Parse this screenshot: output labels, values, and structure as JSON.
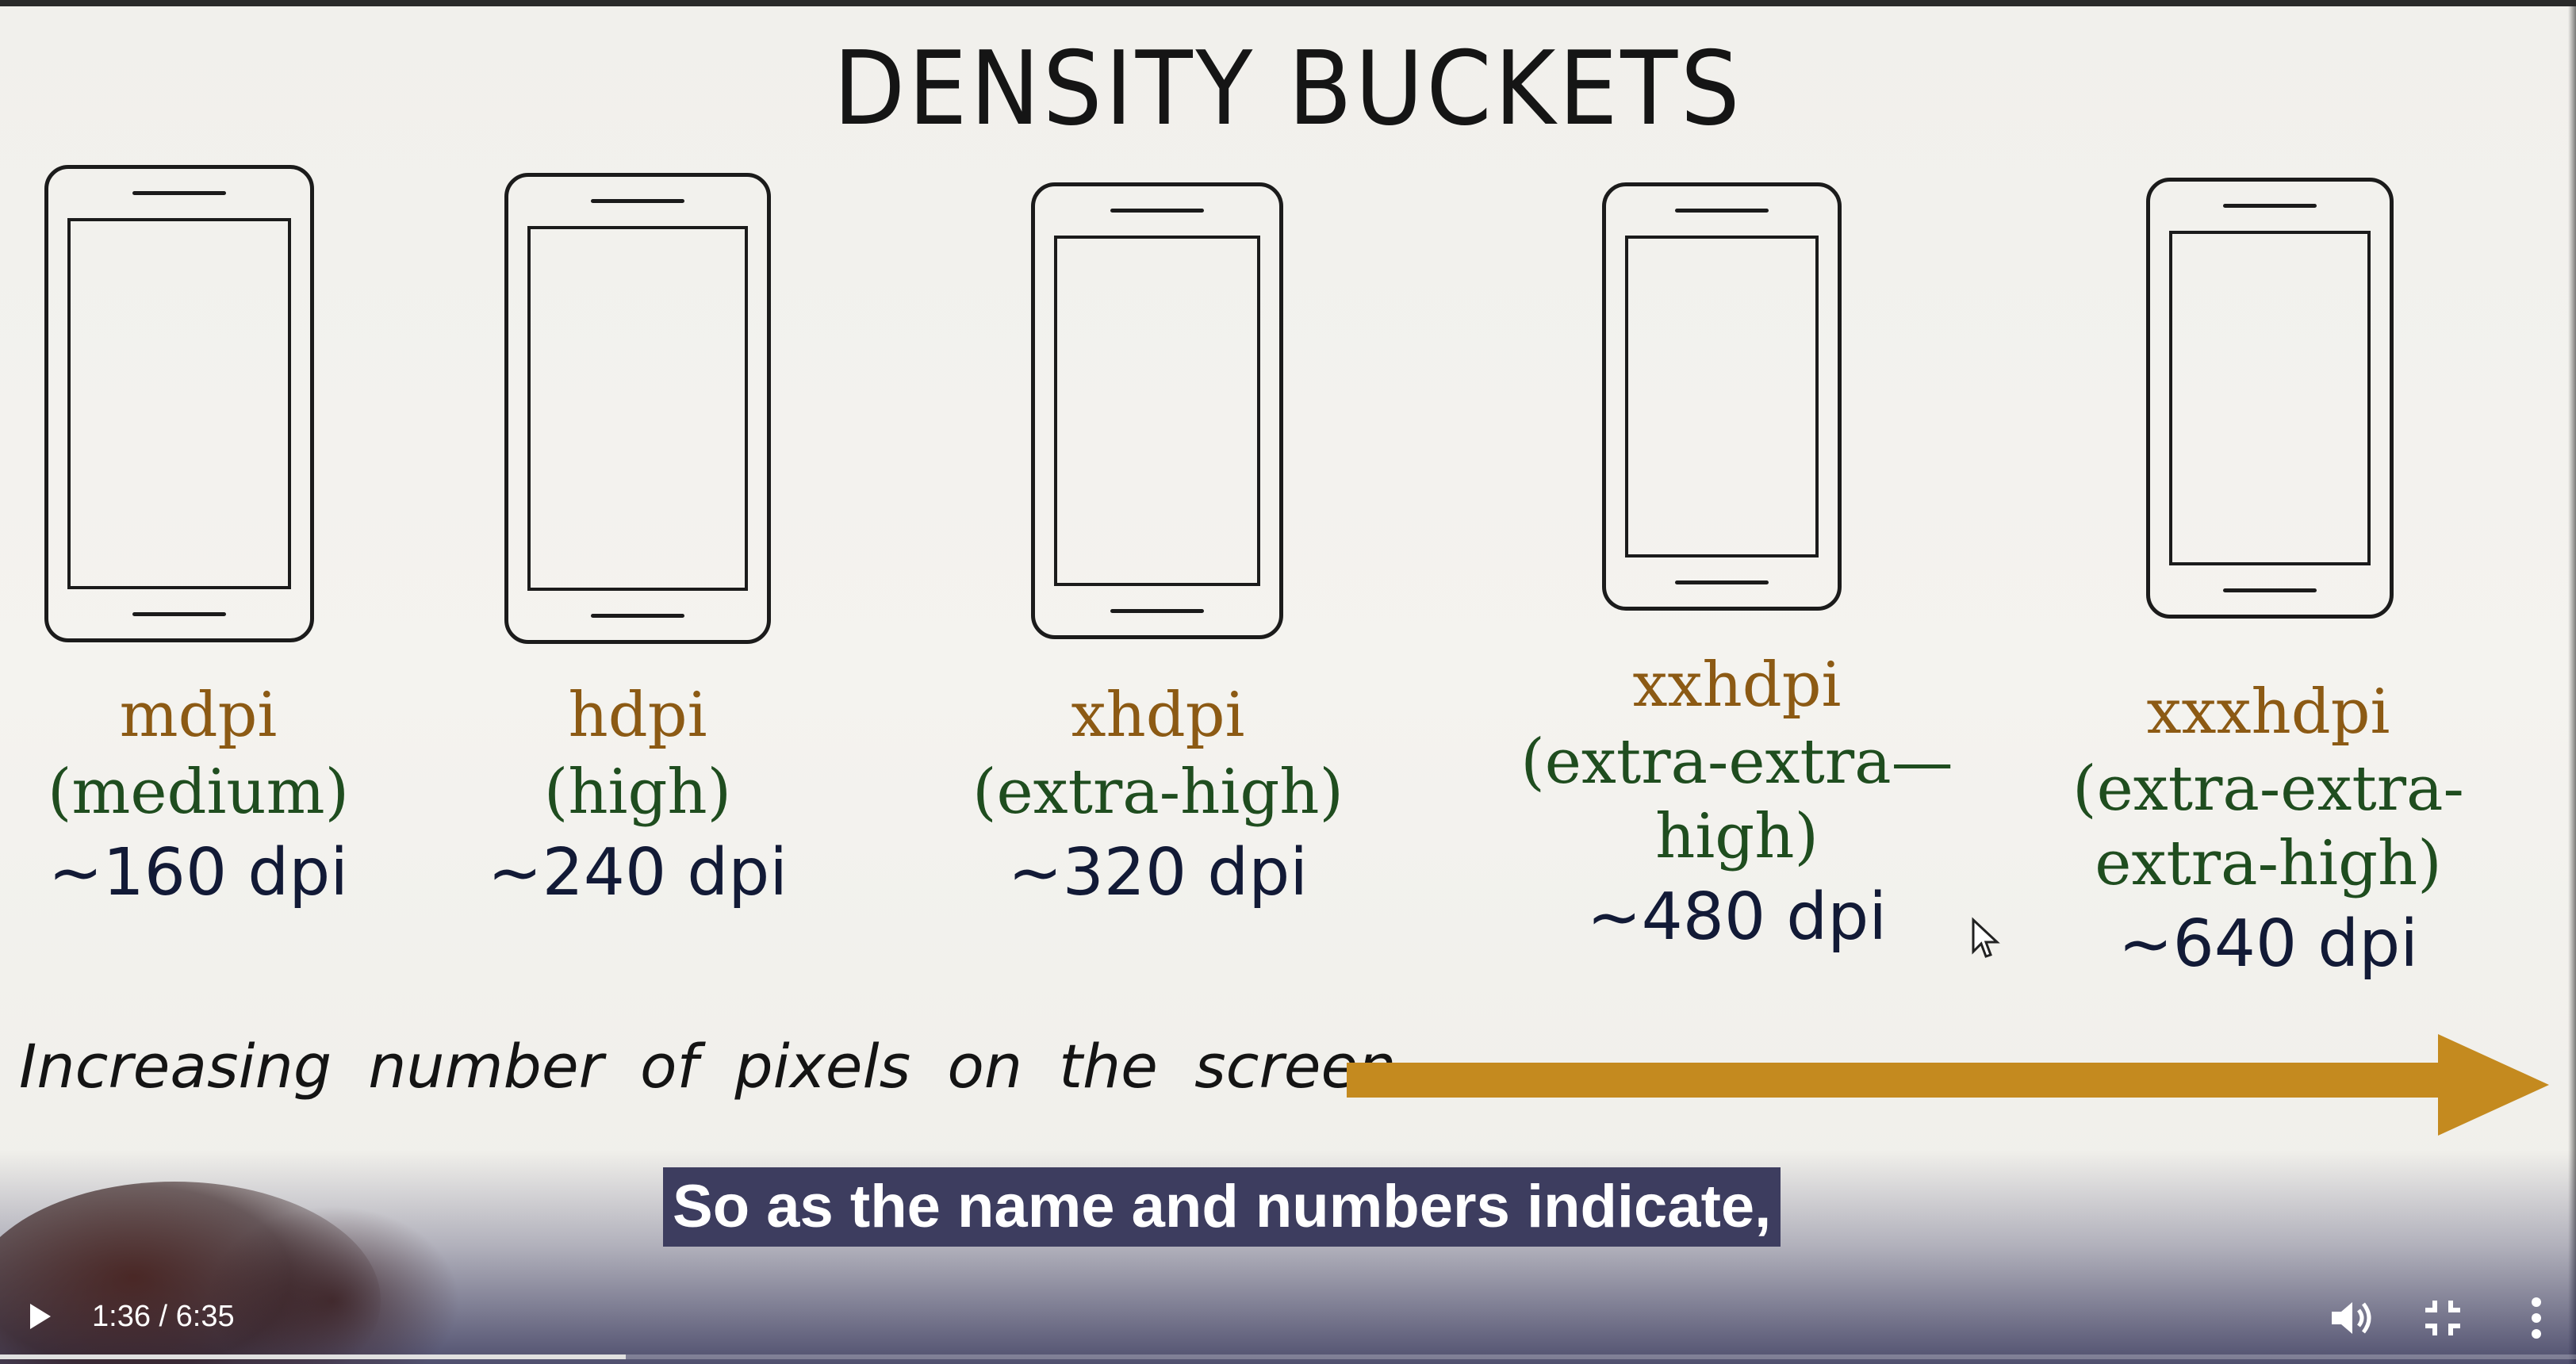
{
  "slide": {
    "title": "DENSITY BUCKETS",
    "buckets": [
      {
        "name": "mdpi",
        "desc": [
          "(medium)"
        ],
        "dpi": "~160 dpi"
      },
      {
        "name": "hdpi",
        "desc": [
          "(high)"
        ],
        "dpi": "~240 dpi"
      },
      {
        "name": "xhdpi",
        "desc": [
          "(extra-high)"
        ],
        "dpi": "~320 dpi"
      },
      {
        "name": "xxhdpi",
        "desc": [
          "(extra-extra—",
          "high)"
        ],
        "dpi": "~480 dpi"
      },
      {
        "name": "xxxhdpi",
        "desc": [
          "(extra-extra-",
          "extra-high)"
        ],
        "dpi": "~640 dpi"
      }
    ],
    "arrow_label": "Increasing number of pixels on the screen",
    "colors": {
      "bucket_name": "#8c5a14",
      "bucket_desc": "#1f4d1f",
      "dpi_text": "#121a36",
      "arrow": "#c48a1f"
    }
  },
  "player": {
    "caption": "So as the name and numbers indicate,",
    "time_display": "1:36 / 6:35",
    "progress_fraction": 0.243,
    "icons": {
      "play": "play-icon",
      "volume": "volume-icon",
      "fullscreen": "exit-fullscreen-icon",
      "more": "more-vertical-icon"
    }
  }
}
